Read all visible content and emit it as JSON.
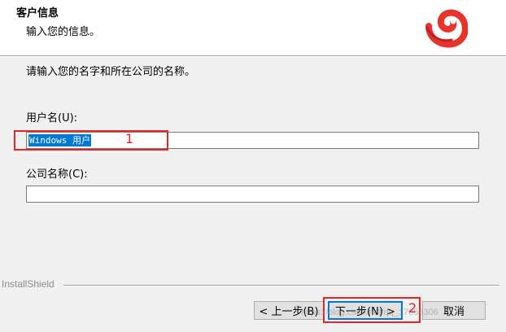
{
  "header": {
    "title": "客户信息",
    "subtitle": "输入您的信息。"
  },
  "main": {
    "instruction": "请输入您的名字和所在公司的名称。",
    "username": {
      "label": "用户名(U):",
      "value": "Windows 用户"
    },
    "company": {
      "label": "公司名称(C):",
      "value": ""
    }
  },
  "footer": {
    "brand": "InstallShield",
    "buttons": {
      "back": "< 上一步(B)",
      "next": "下一步(N) >",
      "cancel": "取消"
    }
  },
  "annotations": {
    "marker_1": "1",
    "marker_2": "2",
    "color": "#e0262a"
  },
  "watermark": "https://blog.csdn.net/qq_17055306",
  "icons": {
    "logo": "installer-swirl-logo"
  },
  "colors": {
    "selection": "#0078d7",
    "logo_red": "#e8332a"
  }
}
